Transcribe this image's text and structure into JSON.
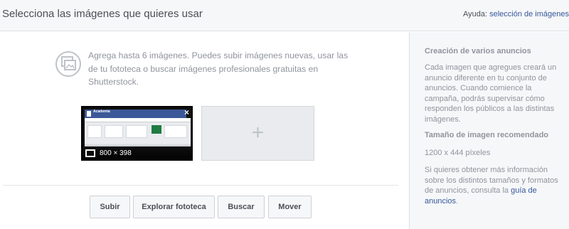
{
  "header": {
    "title": "Selecciona las imágenes que quieres usar",
    "help_prefix": "Ayuda: ",
    "help_link": "selección de imágenes"
  },
  "main": {
    "info_text": "Agrega hasta 6 imágenes. Puedes subir imágenes nuevas, usar las de tu fototeca o buscar imágenes profesionales gratuitas en Shutterstock.",
    "thumbnail": {
      "banner_text": "Academia",
      "size_label": "800 × 398",
      "close_symbol": "×"
    },
    "add_symbol": "+",
    "buttons": {
      "upload": "Subir",
      "browse": "Explorar fototeca",
      "search": "Buscar",
      "move": "Mover"
    }
  },
  "sidebar": {
    "multi_heading": "Creación de varios anuncios",
    "multi_text": "Cada imagen que agregues creará un anuncio diferente en tu conjunto de anuncios. Cuando comience la campaña, podrás supervisar cómo responden los públicos a las distintas imágenes.",
    "size_heading": "Tamaño de imagen recomendado",
    "size_value": "1200 x 444 píxeles",
    "more_text": "Si quieres obtener más información sobre los distintos tamaños y formatos de anuncios, consulta la ",
    "guide_link": "guía de anuncios",
    "period": "."
  },
  "colors": {
    "link": "#365899",
    "muted": "#90949c",
    "panel": "#f6f7f9"
  }
}
